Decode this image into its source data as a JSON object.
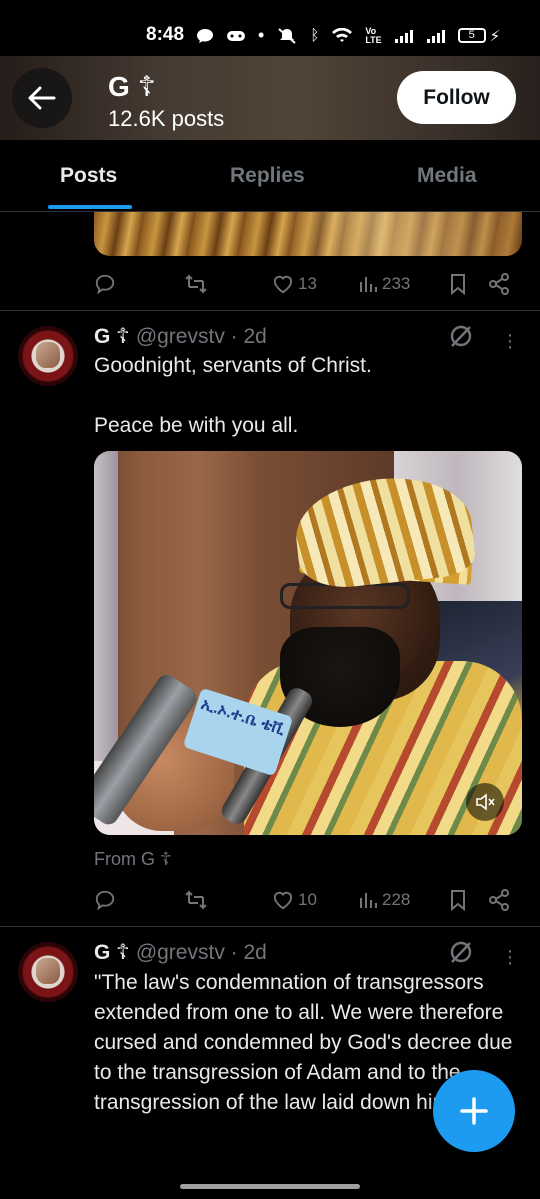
{
  "status_bar": {
    "time": "8:48",
    "battery": "5"
  },
  "header": {
    "title": "G ☦",
    "post_count": "12.6K posts",
    "follow_label": "Follow"
  },
  "tabs": [
    {
      "label": "Posts",
      "active": true
    },
    {
      "label": "Replies",
      "active": false
    },
    {
      "label": "Media",
      "active": false
    }
  ],
  "prev_post": {
    "likes": "13",
    "views": "233"
  },
  "tweet1": {
    "name": "G ☦",
    "handle": "@grevstv · 2d",
    "text": "Goodnight, servants of Christ.\n\nPeace be with you all.",
    "mic_text": "ኢ.ኦ.ተ.ቤ ቴቪ",
    "from_label": "From G ☦",
    "likes": "10",
    "views": "228"
  },
  "tweet2": {
    "name": "G ☦",
    "handle": "@grevstv · 2d",
    "text": "\"The law's condemnation of transgressors extended from one to all. We were therefore cursed and condemned by God's decree due to the transgression of Adam and to the transgression of the law laid down him\""
  },
  "colors": {
    "accent": "#1d9bf0",
    "background": "#000000",
    "muted": "#71767b"
  }
}
